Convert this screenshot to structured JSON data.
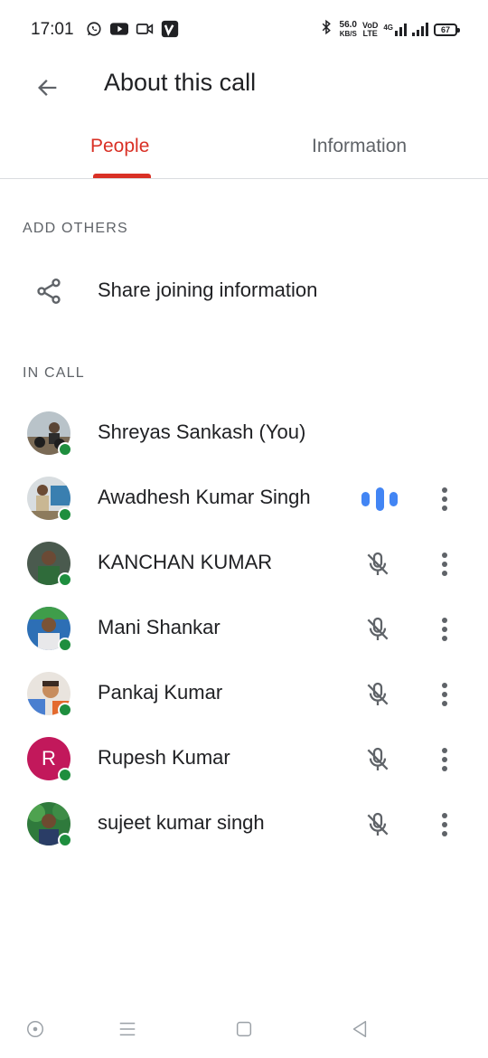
{
  "status_bar": {
    "time": "17:01",
    "apps": [
      "whatsapp-icon",
      "youtube-icon",
      "video-icon",
      "vimeo-icon"
    ],
    "net_speed_value": "56.0",
    "net_speed_unit": "KB/S",
    "volte_top": "VoD",
    "volte_bottom": "LTE",
    "network": "4G",
    "battery": "67"
  },
  "app_bar": {
    "title": "About this call",
    "back_icon": "arrow-back-icon"
  },
  "tabs": [
    {
      "label": "People",
      "active": true
    },
    {
      "label": "Information",
      "active": false
    }
  ],
  "add_others": {
    "header": "ADD OTHERS",
    "share_label": "Share joining information",
    "share_icon": "share-icon"
  },
  "in_call": {
    "header": "IN CALL",
    "participants": [
      {
        "name": "Shreyas Sankash (You)",
        "status": "none"
      },
      {
        "name": "Awadhesh Kumar Singh",
        "status": "speaking"
      },
      {
        "name": "KANCHAN KUMAR",
        "status": "muted"
      },
      {
        "name": "Mani Shankar",
        "status": "muted"
      },
      {
        "name": "Pankaj Kumar",
        "status": "muted"
      },
      {
        "name": "Rupesh Kumar",
        "status": "muted",
        "avatar_letter": "R"
      },
      {
        "name": "sujeet kumar singh",
        "status": "muted"
      }
    ]
  },
  "colors": {
    "accent": "#d93025",
    "presence": "#1e8e3e",
    "speaking": "#4285f4",
    "rupesh_avatar": "#c2185b"
  }
}
